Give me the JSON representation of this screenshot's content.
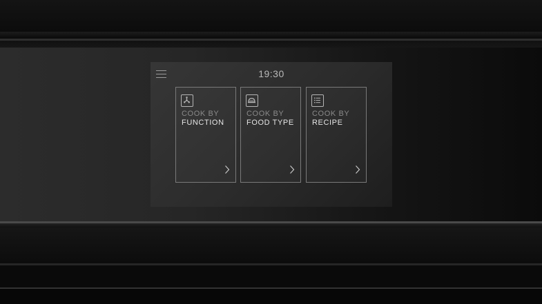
{
  "display": {
    "clock": "19:30",
    "menu_icon": "hamburger-menu-icon",
    "cards": [
      {
        "line1": "COOK BY",
        "line2": "FUNCTION",
        "icon": "fan-function-icon"
      },
      {
        "line1": "COOK BY",
        "line2": "FOOD TYPE",
        "icon": "food-cover-icon"
      },
      {
        "line1": "COOK BY",
        "line2": "RECIPE",
        "icon": "recipe-list-icon"
      }
    ]
  },
  "colors": {
    "screen_background": "#2f2f2f",
    "card_border": "#7a7a7a",
    "primary_text": "#e6e6e6",
    "secondary_text": "#8a8a8a"
  }
}
